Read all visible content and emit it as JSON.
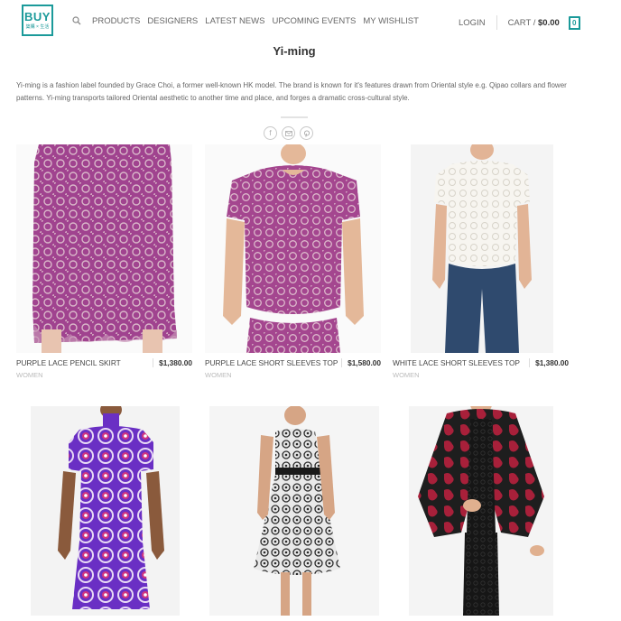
{
  "header": {
    "logo_main": "BUY",
    "logo_sub": "築購 × 生活",
    "nav": [
      "PRODUCTS",
      "DESIGNERS",
      "LATEST NEWS",
      "UPCOMING EVENTS",
      "MY WISHLIST"
    ],
    "login": "LOGIN",
    "cart_label": "CART /",
    "cart_total": "$0.00",
    "cart_count": "0",
    "search_icon": "search-icon",
    "accent_color": "#1b9a9a"
  },
  "page": {
    "title": "Yi-ming",
    "description": "Yi-ming is a fashion label founded by Grace Choi, a former well-known HK model. The brand is known for it's features drawn from Oriental style e.g. Qipao collars and flower patterns. Yi-ming transports tailored Oriental aesthetic to another time and place, and forges a dramatic cross-cultural style.",
    "share_icons": [
      "facebook-icon",
      "email-icon",
      "pinterest-icon"
    ]
  },
  "products": [
    {
      "name": "PURPLE LACE PENCIL SKIRT",
      "price": "$1,380.00",
      "category": "WOMEN",
      "image_subject": "purple lace pencil skirt"
    },
    {
      "name": "PURPLE LACE SHORT SLEEVES TOP",
      "price": "$1,580.00",
      "category": "WOMEN",
      "image_subject": "purple lace short sleeve top"
    },
    {
      "name": "WHITE LACE SHORT SLEEVES TOP",
      "price": "$1,380.00",
      "category": "WOMEN",
      "image_subject": "white lace top with jeans"
    },
    {
      "name": "",
      "price": "",
      "category": "",
      "image_subject": "purple qipao dress"
    },
    {
      "name": "",
      "price": "",
      "category": "",
      "image_subject": "black and white lace dress"
    },
    {
      "name": "",
      "price": "",
      "category": "",
      "image_subject": "black and red cape jacket"
    }
  ]
}
